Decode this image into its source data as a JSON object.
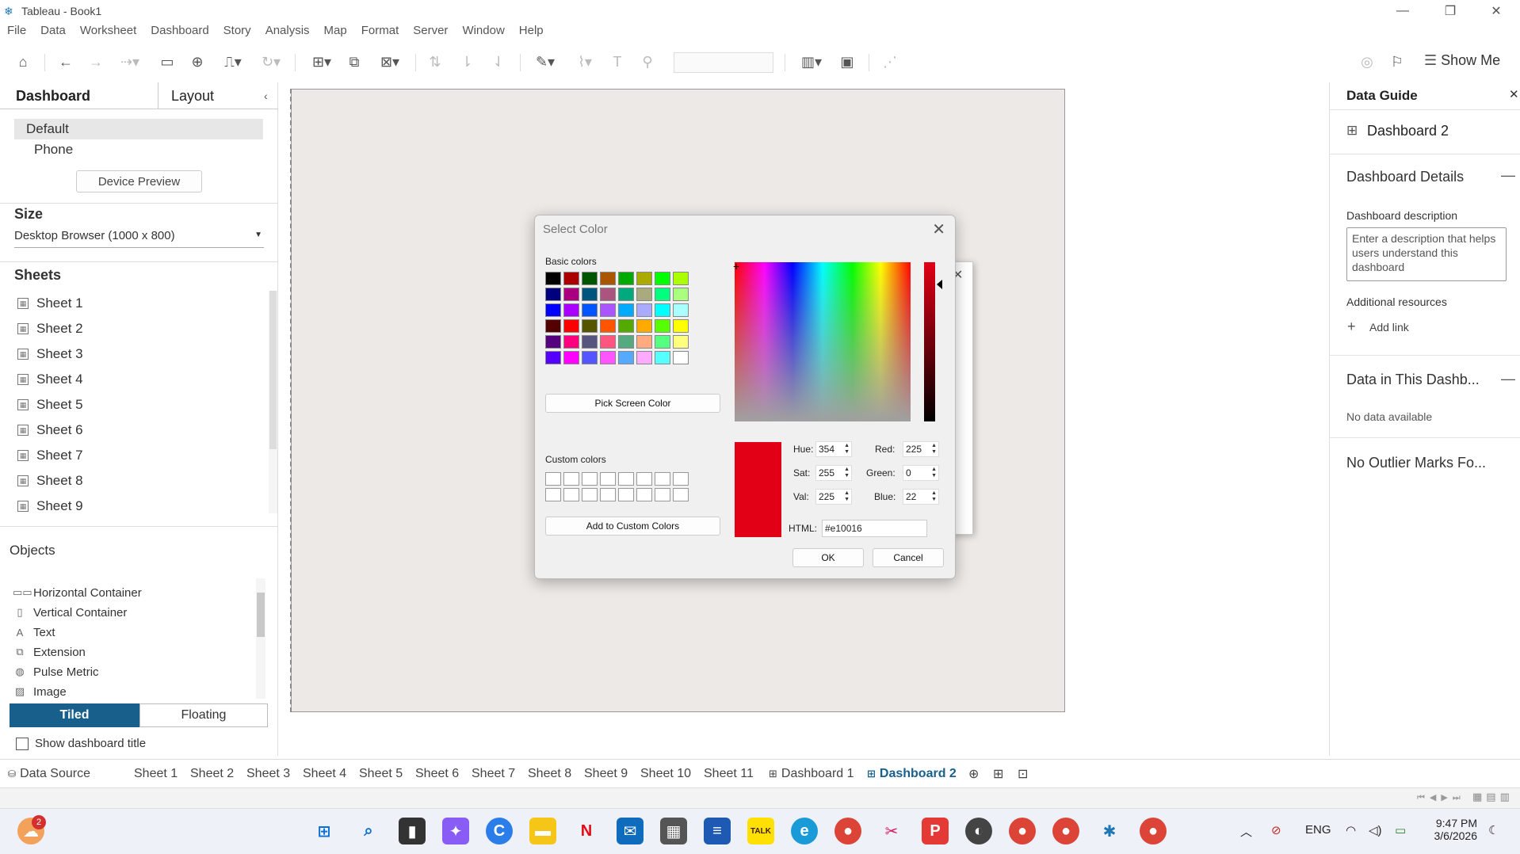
{
  "window": {
    "title": "Tableau - Book1"
  },
  "menu": [
    "File",
    "Data",
    "Worksheet",
    "Dashboard",
    "Story",
    "Analysis",
    "Map",
    "Format",
    "Server",
    "Window",
    "Help"
  ],
  "toolbar": {
    "show_me": "Show Me"
  },
  "left_panel": {
    "tabs": [
      "Dashboard",
      "Layout"
    ],
    "device_options": [
      "Default",
      "Phone"
    ],
    "device_preview_label": "Device Preview",
    "size_title": "Size",
    "size_value": "Desktop Browser (1000 x 800)",
    "sheets_title": "Sheets",
    "sheets": [
      "Sheet 1",
      "Sheet 2",
      "Sheet 3",
      "Sheet 4",
      "Sheet 5",
      "Sheet 6",
      "Sheet 7",
      "Sheet 8",
      "Sheet 9"
    ],
    "objects_title": "Objects",
    "objects": [
      "Horizontal Container",
      "Vertical Container",
      "Text",
      "Extension",
      "Pulse Metric",
      "Image"
    ],
    "tiled_label": "Tiled",
    "floating_label": "Floating",
    "show_title_label": "Show dashboard title"
  },
  "color_dialog": {
    "title": "Select Color",
    "basic_colors_label": "Basic colors",
    "basic_colors": [
      "#000000",
      "#aa0000",
      "#005500",
      "#aa5500",
      "#00aa00",
      "#aaaa00",
      "#00ff00",
      "#aaff00",
      "#00007f",
      "#aa007f",
      "#00557f",
      "#aa557f",
      "#00aa7f",
      "#aaaa7f",
      "#00ff7f",
      "#aaff7f",
      "#0000ff",
      "#aa00ff",
      "#0055ff",
      "#aa55ff",
      "#00aaff",
      "#aaaaff",
      "#00ffff",
      "#aaffff",
      "#550000",
      "#ff0000",
      "#555500",
      "#ff5500",
      "#55aa00",
      "#ffaa00",
      "#55ff00",
      "#ffff00",
      "#55007f",
      "#ff007f",
      "#55557f",
      "#ff557f",
      "#55aa7f",
      "#ffaa7f",
      "#55ff7f",
      "#ffff7f",
      "#5500ff",
      "#ff00ff",
      "#5555ff",
      "#ff55ff",
      "#55aaff",
      "#ffaaff",
      "#55ffff",
      "#ffffff"
    ],
    "pick_screen_label": "Pick Screen Color",
    "custom_colors_label": "Custom colors",
    "add_custom_label": "Add to Custom Colors",
    "hue_label": "Hue:",
    "hue": "354",
    "sat_label": "Sat:",
    "sat": "255",
    "val_label": "Val:",
    "val": "225",
    "red_label": "Red:",
    "red": "225",
    "green_label": "Green:",
    "green": "0",
    "blue_label": "Blue:",
    "blue": "22",
    "html_label": "HTML:",
    "html": "#e10016",
    "ok_label": "OK",
    "cancel_label": "Cancel",
    "current_color": "#e10016"
  },
  "data_guide": {
    "title": "Data Guide",
    "dashboard_name": "Dashboard 2",
    "details_title": "Dashboard Details",
    "description_label": "Dashboard description",
    "description_placeholder": "Enter a description that helps users understand this dashboard",
    "resources_label": "Additional resources",
    "add_link_label": "Add link",
    "data_title": "Data in This Dashb...",
    "no_data": "No data available",
    "outlier_title": "No Outlier Marks Fo..."
  },
  "bottom_tabs": [
    "Data Source",
    "Sheet 1",
    "Sheet 2",
    "Sheet 3",
    "Sheet 4",
    "Sheet 5",
    "Sheet 6",
    "Sheet 7",
    "Sheet 8",
    "Sheet 9",
    "Sheet 10",
    "Sheet 11",
    "Dashboard 1",
    "Dashboard 2"
  ],
  "taskbar": {
    "lang": "ENG",
    "time": "9:47 PM",
    "date": "3/6/2026",
    "weather_badge": "2"
  }
}
